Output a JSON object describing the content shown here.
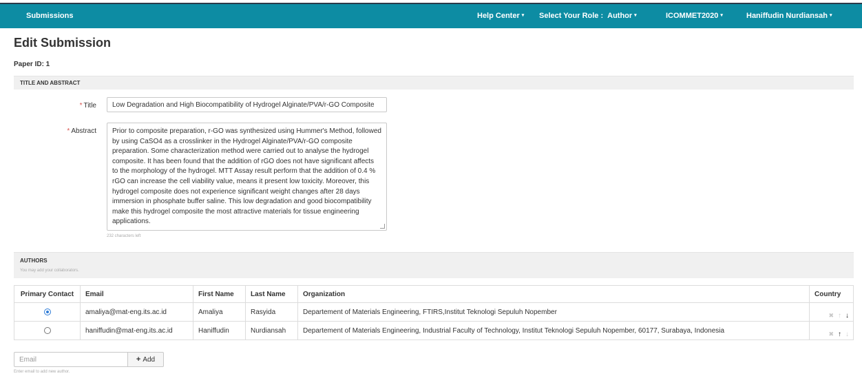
{
  "nav": {
    "brand": "Submissions",
    "help_center": "Help Center",
    "role_label": "Select Your Role :",
    "role_value": "Author",
    "conference": "ICOMMET2020",
    "user": "Haniffudin Nurdiansah",
    "caret": "▾"
  },
  "page": {
    "title": "Edit Submission",
    "paper_id": "Paper ID: 1"
  },
  "title_abstract": {
    "section_title": "TITLE AND ABSTRACT",
    "required_mark": "*",
    "title_label": "Title",
    "title_value": "Low Degradation and High Biocompatibility of Hydrogel Alginate/PVA/r-GO Composite",
    "abstract_label": "Abstract",
    "abstract_value": "Prior to composite preparation, r-GO was synthesized using Hummer's Method, followed by using CaSO4 as a crosslinker in the Hydrogel Alginate/PVA/r-GO composite preparation. Some characterization method were carried out to analyse the hydrogel composite. It has been found that the addition of rGO does not have significant affects to the morphology of the hydrogel. MTT Assay result perform that the addition of 0.4 % rGO can increase the cell viability value, means it present low toxicity. Moreover, this hydrogel composite does not experience significant weight changes after 28 days immersion in phosphate buffer saline. This low degradation and good biocompatibility make this hydrogel composite the most attractive materials for tissue engineering applications.",
    "chars_left": "232 characters left"
  },
  "authors": {
    "section_title": "AUTHORS",
    "subtitle": "You may add your collaborators.",
    "columns": {
      "primary_contact": "Primary Contact",
      "email": "Email",
      "first_name": "First Name",
      "last_name": "Last Name",
      "organization": "Organization",
      "country": "Country"
    },
    "rows": [
      {
        "primary": true,
        "email": "amaliya@mat-eng.its.ac.id",
        "first_name": "Amaliya",
        "last_name": "Rasyida",
        "organization": "Departement of Materials Engineering, FTIRS,Institut Teknologi Sepuluh Nopember",
        "country": ""
      },
      {
        "primary": false,
        "email": "haniffudin@mat-eng.its.ac.id",
        "first_name": "Haniffudin",
        "last_name": "Nurdiansah",
        "organization": "Departement of Materials Engineering, Industrial Faculty of Technology, Institut Teknologi Sepuluh Nopember, 60177, Surabaya, Indonesia",
        "country": ""
      }
    ],
    "icons": {
      "remove": "✖",
      "up": "↑",
      "down": "↓"
    },
    "add": {
      "placeholder": "Email",
      "button_label": "Add",
      "plus": "+",
      "hint": "Enter email to add new author."
    }
  },
  "colors": {
    "navbar": "#0d8ca3",
    "required": "#d9534f",
    "radio_active": "#2d7bd6"
  }
}
